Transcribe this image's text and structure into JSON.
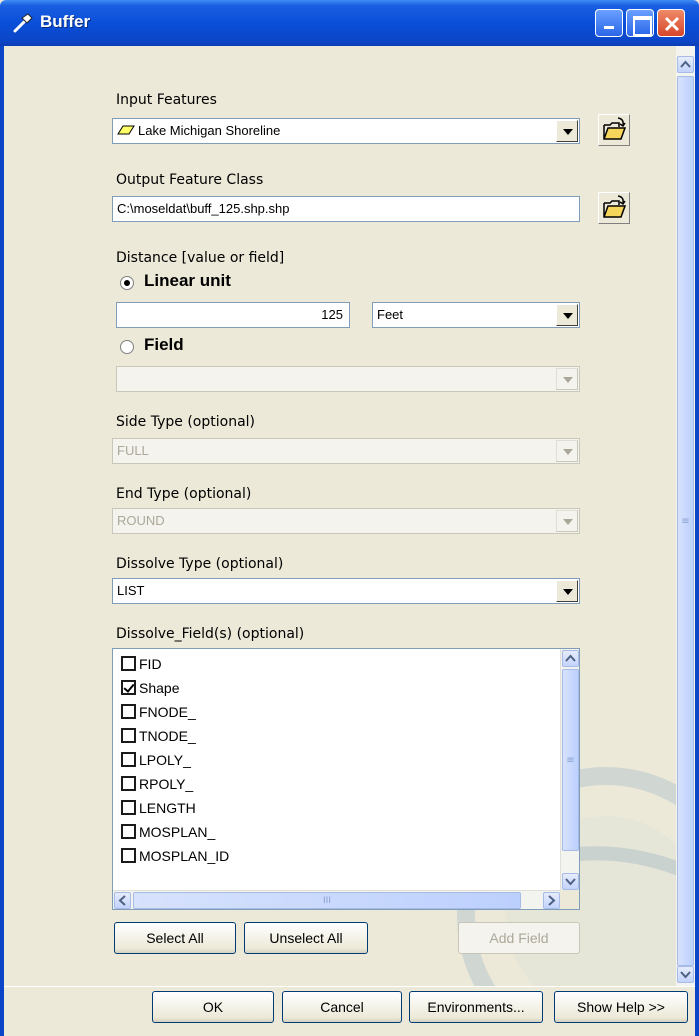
{
  "window": {
    "title": "Buffer"
  },
  "input_features": {
    "label": "Input Features",
    "value": "Lake Michigan Shoreline"
  },
  "output_feature_class": {
    "label": "Output Feature Class",
    "value": "C:\\moseldat\\buff_125.shp.shp"
  },
  "distance": {
    "label": "Distance [value or field]",
    "linear_unit_label": "Linear unit",
    "linear_value": "125",
    "unit": "Feet",
    "field_label": "Field",
    "field_value": ""
  },
  "side_type": {
    "label": "Side Type (optional)",
    "value": "FULL"
  },
  "end_type": {
    "label": "End Type (optional)",
    "value": "ROUND"
  },
  "dissolve_type": {
    "label": "Dissolve Type (optional)",
    "value": "LIST"
  },
  "dissolve_fields": {
    "label": "Dissolve_Field(s) (optional)",
    "items": [
      {
        "name": "FID",
        "checked": false
      },
      {
        "name": "Shape",
        "checked": true
      },
      {
        "name": "FNODE_",
        "checked": false
      },
      {
        "name": "TNODE_",
        "checked": false
      },
      {
        "name": "LPOLY_",
        "checked": false
      },
      {
        "name": "RPOLY_",
        "checked": false
      },
      {
        "name": "LENGTH",
        "checked": false
      },
      {
        "name": "MOSPLAN_",
        "checked": false
      },
      {
        "name": "MOSPLAN_ID",
        "checked": false
      }
    ],
    "hscroll_grip": "III",
    "vscroll_grip": "≡"
  },
  "list_buttons": {
    "select_all": "Select All",
    "unselect_all": "Unselect All",
    "add_field": "Add Field"
  },
  "footer": {
    "ok": "OK",
    "cancel": "Cancel",
    "environments": "Environments...",
    "show_help": "Show Help >>"
  }
}
